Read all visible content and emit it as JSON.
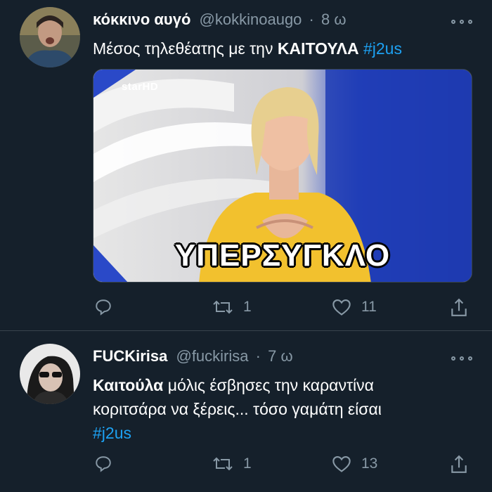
{
  "tweets": [
    {
      "name": "κόκκινο αυγό",
      "handle": "@kokkinoaugo",
      "separator": "·",
      "time": "8 ω",
      "text": {
        "part1": "Μέσος τηλεθέατης με την ",
        "bold": "ΚΑΙΤΟΥΛΑ",
        "space": " ",
        "hashtag": "#j2us"
      },
      "media": {
        "logo": "starHD",
        "caption": "ΥΠΕΡΣΥΓΚΛΟ"
      },
      "actions": {
        "reply_icon": "reply-icon",
        "retweets": "1",
        "likes": "11"
      }
    },
    {
      "name": "FUCKirisa",
      "handle": "@fuckirisa",
      "separator": "·",
      "time": "7 ω",
      "text": {
        "bold": "Καιτούλα",
        "line1": " μόλις έσβησες την καραντίνα",
        "line2": "κοριτσάρα να ξέρεις... τόσο γαμάτη είσαι",
        "hashtag": "#j2us"
      },
      "actions": {
        "reply_icon": "reply-icon",
        "retweets": "1",
        "likes": "13"
      }
    }
  ],
  "colors": {
    "background": "#15202b",
    "secondary_text": "#8899a6",
    "hashtag": "#1da1f2",
    "divider": "#38444d"
  }
}
